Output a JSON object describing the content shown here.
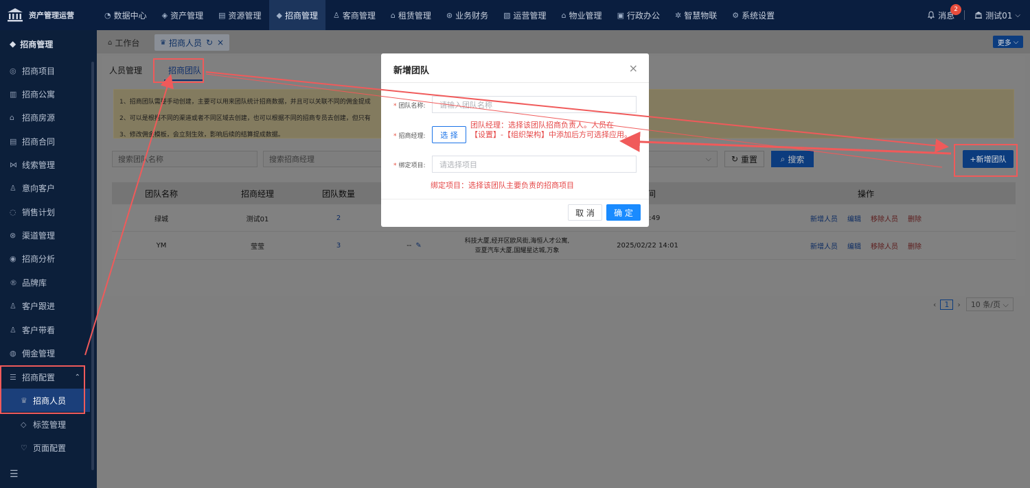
{
  "app": {
    "title": "资产管理运营"
  },
  "nav": [
    {
      "icon": "◔",
      "label": "数据中心"
    },
    {
      "icon": "◈",
      "label": "资产管理"
    },
    {
      "icon": "▤",
      "label": "资源管理"
    },
    {
      "icon": "◆",
      "label": "招商管理"
    },
    {
      "icon": "♙",
      "label": "客商管理"
    },
    {
      "icon": "⌂",
      "label": "租赁管理"
    },
    {
      "icon": "⊛",
      "label": "业务财务"
    },
    {
      "icon": "▧",
      "label": "运营管理"
    },
    {
      "icon": "⌂",
      "label": "物业管理"
    },
    {
      "icon": "▣",
      "label": "行政办公"
    },
    {
      "icon": "✲",
      "label": "智慧物联"
    },
    {
      "icon": "⚙",
      "label": "系统设置"
    }
  ],
  "top_right": {
    "messages_label": "消息",
    "badge_count": "2",
    "user_name": "测试01"
  },
  "sidebar": {
    "header": "招商管理",
    "items": [
      {
        "icon": "◎",
        "label": "招商项目"
      },
      {
        "icon": "▥",
        "label": "招商公寓"
      },
      {
        "icon": "⌂",
        "label": "招商房源"
      },
      {
        "icon": "▤",
        "label": "招商合同"
      },
      {
        "icon": "⋈",
        "label": "线索管理"
      },
      {
        "icon": "♙",
        "label": "意向客户"
      },
      {
        "icon": "◌",
        "label": "销售计划"
      },
      {
        "icon": "⊗",
        "label": "渠道管理"
      },
      {
        "icon": "◉",
        "label": "招商分析"
      },
      {
        "icon": "®",
        "label": "品牌库"
      },
      {
        "icon": "♙",
        "label": "客户跟进"
      },
      {
        "icon": "♙",
        "label": "客户带看"
      },
      {
        "icon": "◍",
        "label": "佣金管理"
      },
      {
        "icon": "☰",
        "label": "招商配置"
      },
      {
        "icon": "♛",
        "label": "招商人员"
      },
      {
        "icon": "◇",
        "label": "标签管理"
      },
      {
        "icon": "♡",
        "label": "页面配置"
      }
    ]
  },
  "tabs": {
    "workbench": "工作台",
    "current": "招商人员",
    "more": "更多"
  },
  "subtabs": {
    "a": "人员管理",
    "b": "招商团队"
  },
  "notice": {
    "line1": "1、招商团队需要手动创建，主要可以用来团队统计招商数据，并且可以关联不同的佣金提成",
    "line2": "2、可以是根据不同的渠道或者不同区域去创建，也可以根据不同的招商专员去创建，但只有",
    "line3": "3、修改佣金模板，会立刻生效，影响后续的结算提成数据。"
  },
  "filters": {
    "team_name_placeholder": "搜索团队名称",
    "manager_placeholder": "搜索招商经理",
    "reset": "重置",
    "search": "搜索",
    "add_team": "+新增团队"
  },
  "table": {
    "headers": {
      "c1": "团队名称",
      "c2": "招商经理",
      "c3": "团队数量",
      "c6": "时间",
      "c7": "操作"
    },
    "rows": [
      {
        "name": "绿城",
        "manager": "测试01",
        "count": "2",
        "projects": "",
        "time": "6 16:49"
      },
      {
        "name": "YM",
        "manager": "莹莹",
        "count": "3",
        "commission": "--",
        "projects": "科技大厦,经开区欧风街,海恒人才公寓,亚夏汽车大厦,国耀星达城,万象",
        "time": "2025/02/22 14:01"
      }
    ],
    "ops": {
      "add_member": "新增人员",
      "edit": "编辑",
      "remove_member": "移除人员",
      "delete": "删除"
    }
  },
  "pagination": {
    "page": "1",
    "page_size": "10 条/页"
  },
  "modal": {
    "title": "新增团队",
    "team_name_label": "团队名称:",
    "team_name_placeholder": "请输入团队名称",
    "manager_label": "招商经理:",
    "choose_label": "选 择",
    "project_label": "绑定项目:",
    "project_placeholder": "请选择项目",
    "cancel": "取 消",
    "ok": "确 定"
  },
  "annotations": {
    "manager_note_line1": "团队经理：选择该团队招商负责人。人员在",
    "manager_note_line2": "【设置】-【组织架构】中添加后方可选择应用。",
    "project_note": "绑定项目：选择该团队主要负责的招商项目"
  },
  "colors": {
    "topbar": "#0a1e3f",
    "sidebar": "#0c1f3a",
    "primary": "#1a8bff",
    "annotation": "#f05a5a"
  }
}
